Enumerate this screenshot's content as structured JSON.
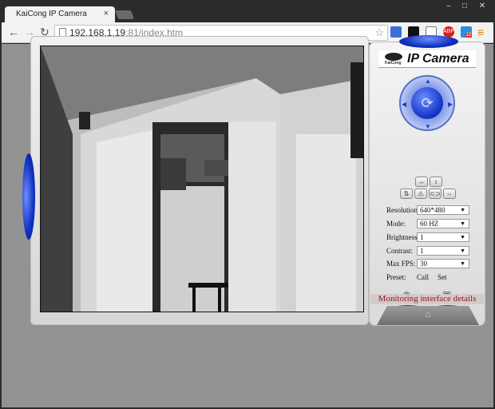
{
  "browser": {
    "tab_title": "KaiCong IP Camera",
    "tab_close": "×",
    "url_host": "192.168.1.19",
    "url_rest": ":81/index.htm",
    "window_buttons": [
      "–",
      "□",
      "✕"
    ],
    "extensions": [
      {
        "name": "folder-extension",
        "label": ""
      },
      {
        "name": "black-square-extension",
        "label": ""
      },
      {
        "name": "cast-extension",
        "label": ""
      },
      {
        "name": "abp-extension",
        "label": "ABP"
      },
      {
        "name": "badge-extension",
        "label": "12"
      }
    ]
  },
  "camera": {
    "brand": "IP Camera",
    "brand_small": "KaiCong",
    "controls": {
      "resolution": {
        "label": "Resolution:",
        "value": "640*480"
      },
      "mode": {
        "label": "Mode:",
        "value": "60 HZ"
      },
      "brightness": {
        "label": "Brightness:",
        "value": "1"
      },
      "contrast": {
        "label": "Contrast:",
        "value": "1"
      },
      "max_fps": {
        "label": "Max FPS:",
        "value": "30"
      }
    },
    "preset": {
      "label": "Preset:",
      "call": "Call",
      "set": "Set"
    },
    "footer": "Monitoring interface details"
  },
  "colors": {
    "accent": "#1a38c0",
    "footer_text": "#8b1a1a"
  }
}
